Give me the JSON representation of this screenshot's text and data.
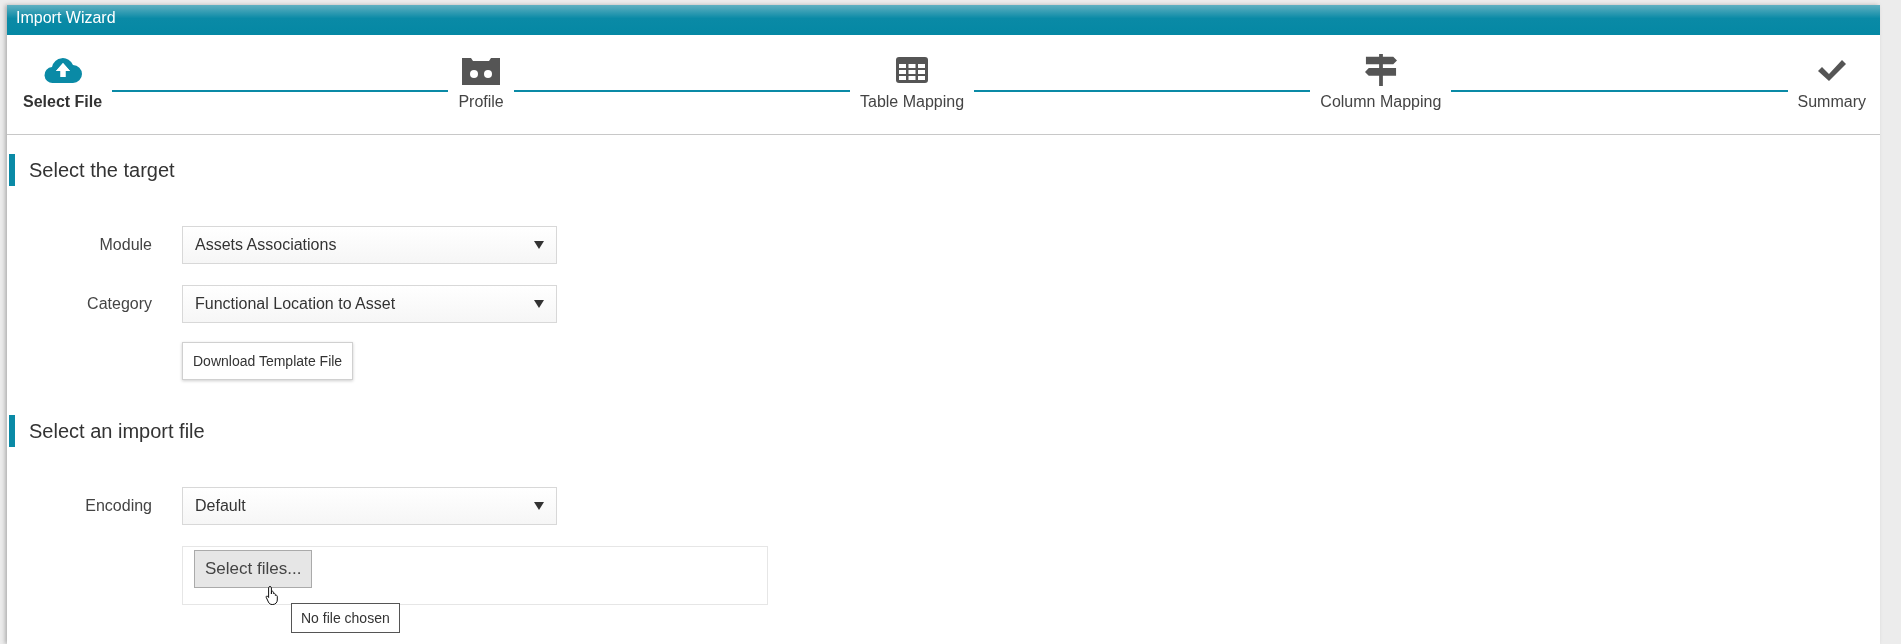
{
  "window": {
    "title": "Import Wizard"
  },
  "steps": [
    {
      "label": "Select File",
      "selected": true
    },
    {
      "label": "Profile",
      "selected": false
    },
    {
      "label": "Table Mapping",
      "selected": false
    },
    {
      "label": "Column Mapping",
      "selected": false
    },
    {
      "label": "Summary",
      "selected": false
    }
  ],
  "sections": [
    {
      "title": "Select the target",
      "fields": [
        {
          "kind": "select",
          "label": "Module",
          "value": "Assets Associations"
        },
        {
          "kind": "select",
          "label": "Category",
          "value": "Functional Location to Asset"
        },
        {
          "kind": "button",
          "label": "Download Template File"
        }
      ]
    },
    {
      "title": "Select an import file",
      "fields": [
        {
          "kind": "select",
          "label": "Encoding",
          "value": "Default"
        },
        {
          "kind": "upload",
          "button": "Select files...",
          "tooltip": "No file chosen"
        }
      ]
    }
  ]
}
